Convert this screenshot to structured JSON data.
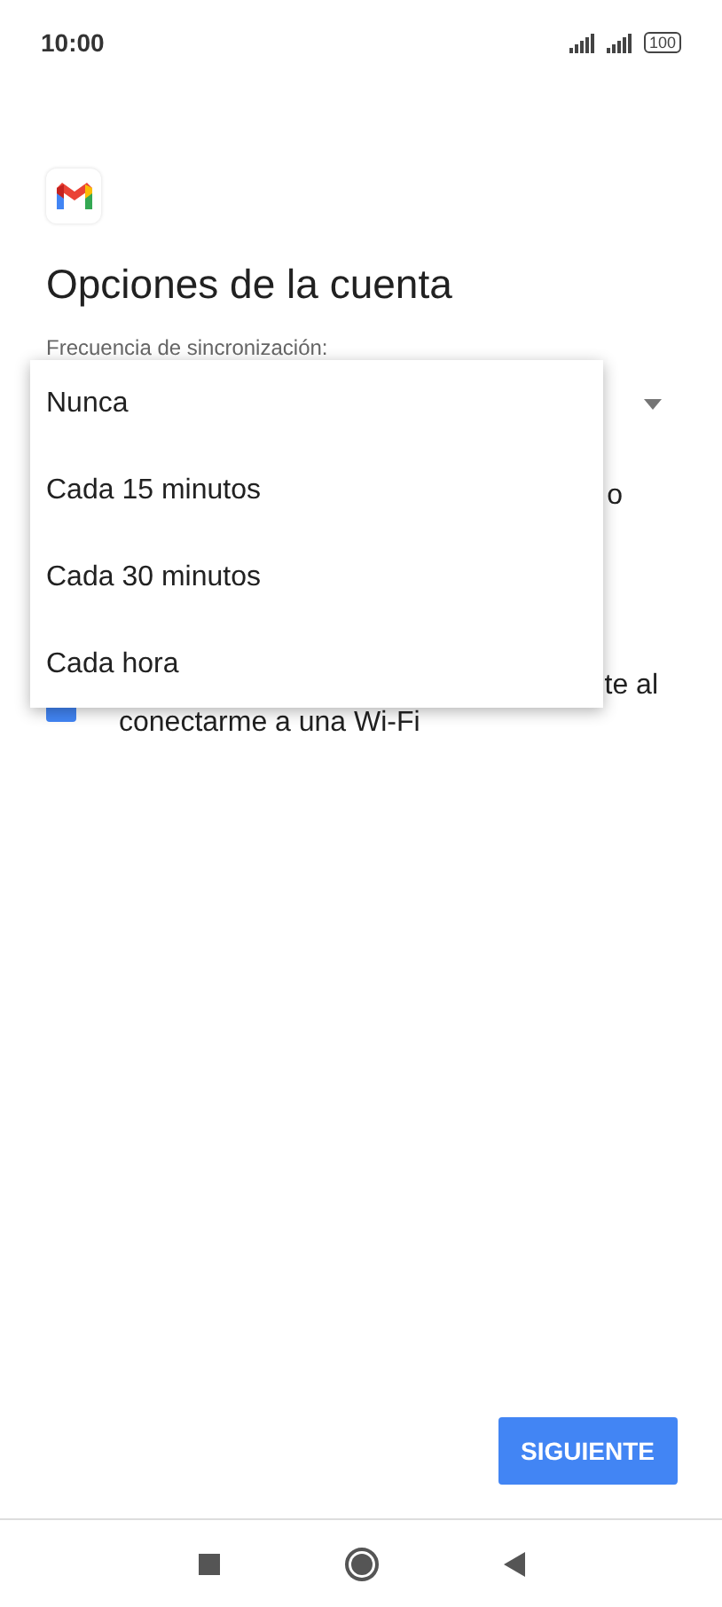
{
  "status_bar": {
    "time": "10:00",
    "battery": "100"
  },
  "title": "Opciones de la cuenta",
  "sync_field": {
    "label": "Frecuencia de sincronización:"
  },
  "covered_option": {
    "visible_text": "o"
  },
  "wifi_option": {
    "checked": true,
    "line_1_visible_text": "te al",
    "line_2": "conectarme a una Wi-Fi"
  },
  "menu": {
    "items": [
      {
        "label": "Nunca"
      },
      {
        "label": "Cada 15 minutos"
      },
      {
        "label": "Cada 30 minutos"
      },
      {
        "label": "Cada hora"
      }
    ]
  },
  "next_button": "SIGUIENTE"
}
